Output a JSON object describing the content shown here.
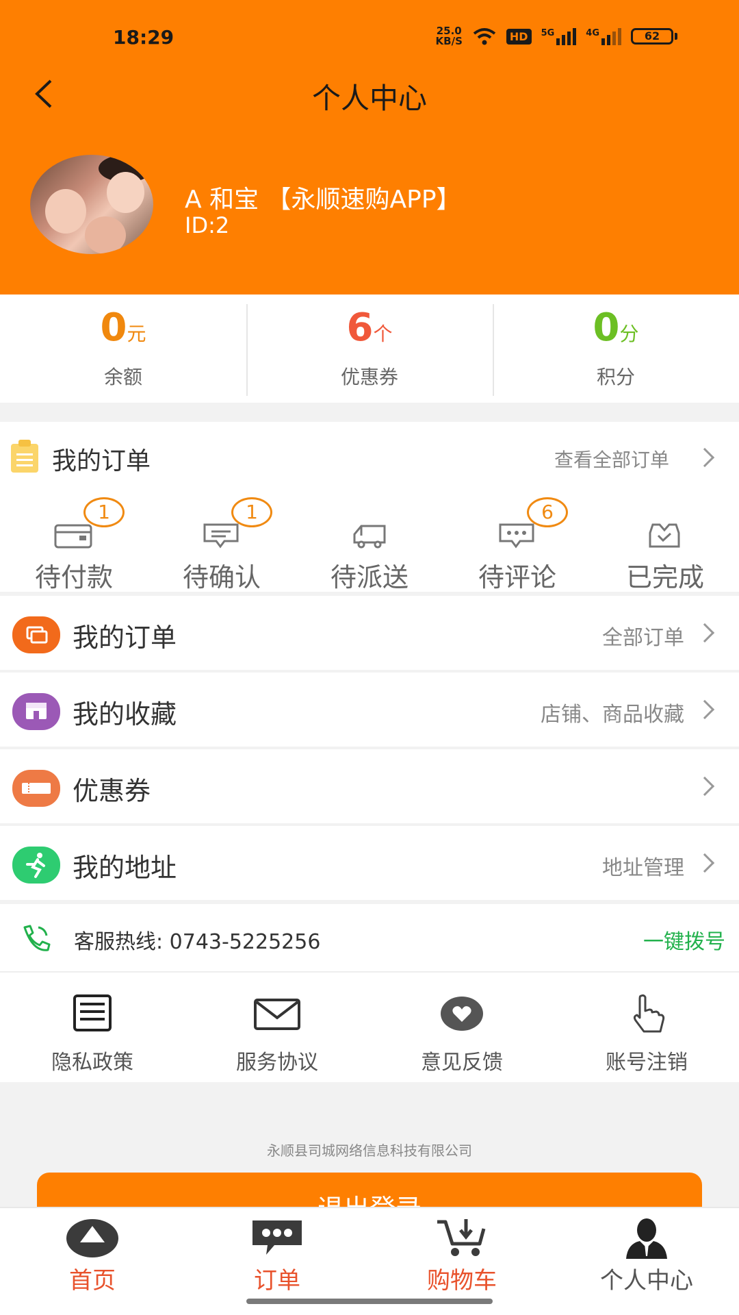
{
  "status_bar": {
    "time": "18:29",
    "net_speed_value": "25.0",
    "net_speed_unit": "KB/S",
    "hd_label": "HD",
    "signal1_label": "5G",
    "signal2_label": "4G",
    "battery": "62",
    "icons": [
      "wifi-icon",
      "signal-icon",
      "battery-icon"
    ]
  },
  "header": {
    "title": "个人中心",
    "user_name": "A 和宝 【永顺速购APP】",
    "user_id": "ID:2",
    "bg_color": "#fe7f01"
  },
  "stats": [
    {
      "value": "0",
      "unit": "元",
      "label": "余额",
      "color": "#f0880e"
    },
    {
      "value": "6",
      "unit": "个",
      "label": "优惠券",
      "color": "#f0583a"
    },
    {
      "value": "0",
      "unit": "分",
      "label": "积分",
      "color": "#6cbf24"
    }
  ],
  "orders": {
    "title": "我的订单",
    "more_label": "查看全部订单",
    "tabs": [
      {
        "label": "待付款",
        "badge": "1",
        "icon": "wallet-icon"
      },
      {
        "label": "待确认",
        "badge": "1",
        "icon": "confirm-icon"
      },
      {
        "label": "待派送",
        "badge": "",
        "icon": "truck-icon"
      },
      {
        "label": "待评论",
        "badge": "6",
        "icon": "comment-icon"
      },
      {
        "label": "已完成",
        "badge": "",
        "icon": "completed-icon"
      }
    ]
  },
  "menu": [
    {
      "label": "我的订单",
      "right": "全部订单",
      "icon": "order-list-icon",
      "color": "#f26a1b"
    },
    {
      "label": "我的收藏",
      "right": "店铺、商品收藏",
      "icon": "favorites-icon",
      "color": "#9b59b6"
    },
    {
      "label": "优惠券",
      "right": "",
      "icon": "coupon-icon",
      "color": "#ee7a45"
    },
    {
      "label": "我的地址",
      "right": "地址管理",
      "icon": "address-icon",
      "color": "#2ecc71"
    }
  ],
  "hotline": {
    "text": "客服热线: 0743-5225256",
    "dial_label": "一键拨号"
  },
  "links": [
    {
      "label": "隐私政策",
      "icon": "privacy-icon"
    },
    {
      "label": "服务协议",
      "icon": "mail-icon"
    },
    {
      "label": "意见反馈",
      "icon": "feedback-icon"
    },
    {
      "label": "账号注销",
      "icon": "hand-icon"
    }
  ],
  "footer": {
    "company": "永顺县司城网络信息科技有限公司",
    "logout_label": "退出登录"
  },
  "bottom_nav": [
    {
      "label": "首页",
      "icon": "home-icon",
      "color": "#e8522c"
    },
    {
      "label": "订单",
      "icon": "chat-icon",
      "color": "#e8522c"
    },
    {
      "label": "购物车",
      "icon": "cart-icon",
      "color": "#e8522c"
    },
    {
      "label": "个人中心",
      "icon": "profile-icon",
      "color": "#555555"
    }
  ]
}
